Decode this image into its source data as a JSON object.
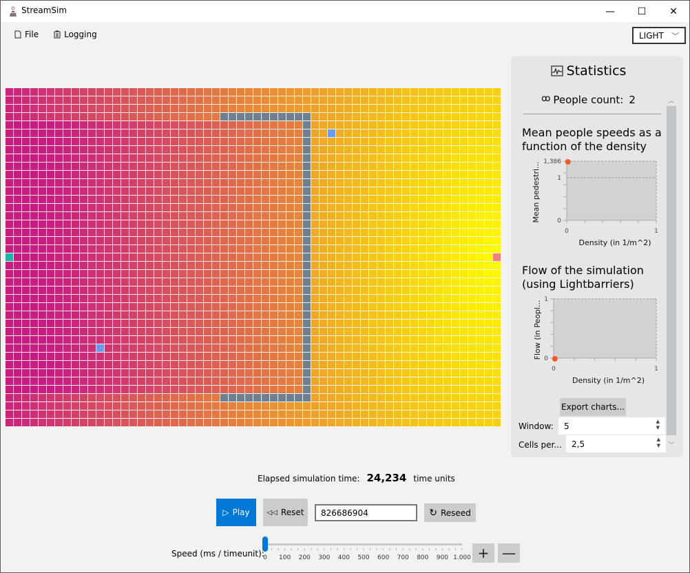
{
  "window": {
    "title": "StreamSim",
    "controls": {
      "minimize": "—",
      "maximize": "☐",
      "close": "✕"
    }
  },
  "menu": {
    "items": [
      {
        "label": "File",
        "icon": "document-icon"
      },
      {
        "label": "Logging",
        "icon": "clipboard-icon"
      }
    ]
  },
  "theme_select": {
    "value": "LIGHT"
  },
  "grid": {
    "columns": 60,
    "rows": 41,
    "gradient": {
      "near": "#c71d7f",
      "mid": "#e8883a",
      "far": "#fefc00"
    },
    "wall_color": "#6f8091",
    "cells": {
      "walls": [
        {
          "type": "h",
          "row": 3,
          "from": 26,
          "to": 36
        },
        {
          "type": "v",
          "col": 36,
          "from": 3,
          "to": 37
        },
        {
          "type": "h",
          "row": 37,
          "from": 26,
          "to": 36
        }
      ],
      "people": [
        {
          "col": 39,
          "row": 5,
          "color": "#6a9bf0"
        },
        {
          "col": 11,
          "row": 31,
          "color": "#6a9bf0"
        }
      ],
      "spawn": {
        "col": 0,
        "row": 20,
        "color": "#1fb3aa"
      },
      "exit": {
        "col": 59,
        "row": 20,
        "color": "#f08080"
      }
    }
  },
  "statistics": {
    "title": "Statistics",
    "people_count_label": "People count:",
    "people_count": "2",
    "export_label": "Export charts...",
    "window_label": "Window:",
    "window_value": "5",
    "cells_label": "Cells per...",
    "cells_value": "2,5"
  },
  "chart_data": [
    {
      "type": "scatter",
      "title": "Mean people speeds as a function of the density",
      "xlabel": "Density (in 1/m^2)",
      "ylabel": "Mean pedestri...",
      "xlim": [
        0,
        1
      ],
      "ylim": [
        0,
        1.386
      ],
      "x_ticks": [
        "0",
        "1"
      ],
      "y_ticks": [
        "0",
        "1",
        "1,386"
      ],
      "gridlines_y": [
        1,
        1.386
      ],
      "series": [
        {
          "name": "speed",
          "color": "#f05a28",
          "points": [
            [
              0.005,
              1.386
            ]
          ]
        }
      ]
    },
    {
      "type": "scatter",
      "title": "Flow of the simulation (using Lightbarriers)",
      "xlabel": "Density (in 1/m^2)",
      "ylabel": "Flow (in Peopl...",
      "xlim": [
        0,
        1
      ],
      "ylim": [
        0,
        1
      ],
      "x_ticks": [
        "0",
        "1"
      ],
      "y_ticks": [
        "0",
        "1"
      ],
      "gridlines_y": [
        1
      ],
      "series": [
        {
          "name": "flow",
          "color": "#f05a28",
          "points": [
            [
              0.005,
              0.0
            ]
          ]
        }
      ]
    }
  ],
  "simulation": {
    "elapsed_label": "Elapsed simulation time:",
    "elapsed_value": "24,234",
    "elapsed_unit": "time units",
    "play_label": "Play",
    "reset_label": "Reset",
    "seed_value": "826686904",
    "reseed_label": "Reseed",
    "speed_label": "Speed (ms / timeunit):",
    "speed_value": 0,
    "speed_min": 0,
    "speed_max": 1000,
    "speed_ticks": [
      "0",
      "100",
      "200",
      "300",
      "400",
      "500",
      "600",
      "700",
      "800",
      "900",
      "1.000"
    ],
    "plus_label": "+",
    "minus_label": "—"
  }
}
